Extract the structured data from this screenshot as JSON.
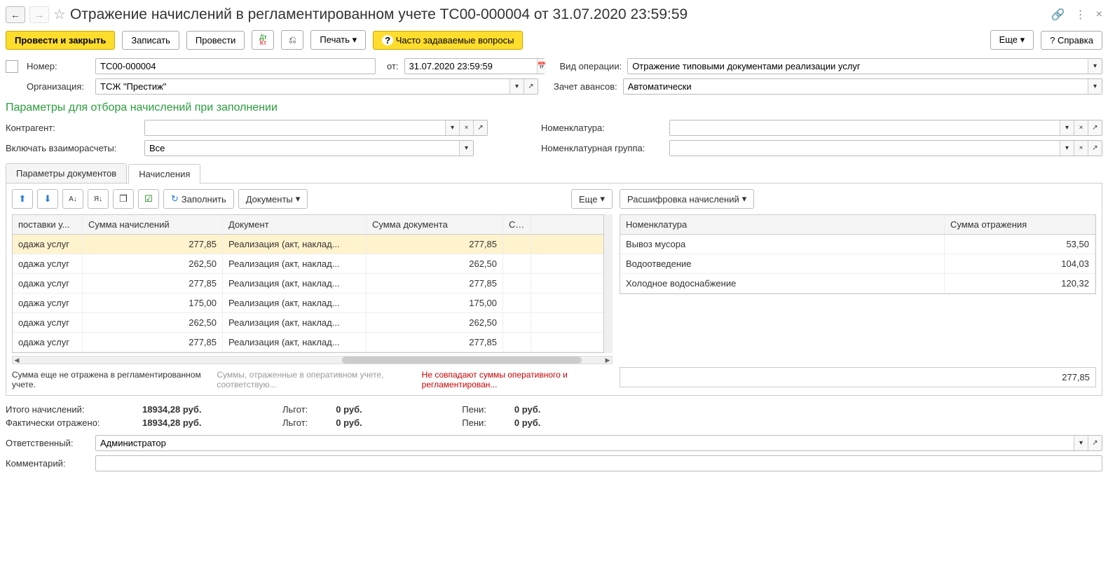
{
  "header": {
    "title": "Отражение начислений в регламентированном учете ТС00-000004 от 31.07.2020 23:59:59"
  },
  "toolbar": {
    "post_close": "Провести и закрыть",
    "save": "Записать",
    "post": "Провести",
    "print": "Печать",
    "faq": "Часто задаваемые вопросы",
    "more": "Еще",
    "help": "Справка"
  },
  "form": {
    "number_label": "Номер:",
    "number": "ТС00-000004",
    "date_label": "от:",
    "date": "31.07.2020 23:59:59",
    "operation_label": "Вид операции:",
    "operation": "Отражение типовыми документами реализации услуг",
    "org_label": "Организация:",
    "org": "ТСЖ \"Престиж\"",
    "advance_label": "Зачет авансов:",
    "advance": "Автоматически"
  },
  "filter": {
    "title": "Параметры для отбора начислений при заполнении",
    "contragent_label": "Контрагент:",
    "settlements_label": "Включать взаиморасчеты:",
    "settlements": "Все",
    "nomenclature_label": "Номенклатура:",
    "nomgroup_label": "Номенклатурная группа:"
  },
  "tabs": {
    "params": "Параметры документов",
    "accruals": "Начисления"
  },
  "panel": {
    "fill": "Заполнить",
    "documents": "Документы",
    "more": "Еще",
    "decode": "Расшифровка начислений"
  },
  "tableL": {
    "h_type": "поставки у...",
    "h_sum": "Сумма начислений",
    "h_doc": "Документ",
    "h_docsum": "Сумма документа",
    "h_acc": "Сче",
    "rows": [
      {
        "type": "одажа услуг",
        "sum": "277,85",
        "doc": "Реализация (акт, наклад...",
        "docsum": "277,85"
      },
      {
        "type": "одажа услуг",
        "sum": "262,50",
        "doc": "Реализация (акт, наклад...",
        "docsum": "262,50"
      },
      {
        "type": "одажа услуг",
        "sum": "277,85",
        "doc": "Реализация (акт, наклад...",
        "docsum": "277,85"
      },
      {
        "type": "одажа услуг",
        "sum": "175,00",
        "doc": "Реализация (акт, наклад...",
        "docsum": "175,00"
      },
      {
        "type": "одажа услуг",
        "sum": "262,50",
        "doc": "Реализация (акт, наклад...",
        "docsum": "262,50"
      },
      {
        "type": "одажа услуг",
        "sum": "277,85",
        "doc": "Реализация (акт, наклад...",
        "docsum": "277,85"
      }
    ]
  },
  "tableR": {
    "h_nom": "Номенклатура",
    "h_sum": "Сумма отражения",
    "rows": [
      {
        "nom": "Вывоз мусора",
        "sum": "53,50"
      },
      {
        "nom": "Водоотведение",
        "sum": "104,03"
      },
      {
        "nom": "Холодное водоснабжение",
        "sum": "120,32"
      }
    ],
    "total": "277,85"
  },
  "legend": {
    "l1": "Сумма еще не отражена в регламентированном учете.",
    "l2": "Суммы, отраженные в оперативном учете, соответствую...",
    "l3": "Не совпадают суммы оперативного и регламентирован..."
  },
  "totals": {
    "total_label": "Итого начислений:",
    "total_val": "18934,28 руб.",
    "lgot_label": "Льгот:",
    "lgot_val": "0 руб.",
    "peni_label": "Пени:",
    "peni_val": "0 руб.",
    "fact_label": "Фактически отражено:",
    "fact_val": "18934,28 руб."
  },
  "footer": {
    "resp_label": "Ответственный:",
    "resp": "Администратор",
    "comment_label": "Комментарий:"
  }
}
